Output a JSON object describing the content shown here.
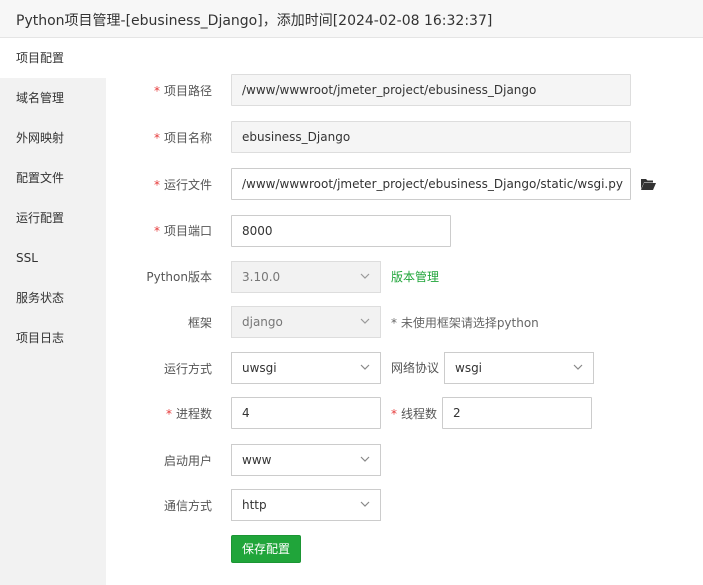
{
  "window": {
    "title": "Python项目管理-[ebusiness_Django]，添加时间[2024-02-08 16:32:37]"
  },
  "sidebar": {
    "items": [
      {
        "label": "项目配置",
        "active": true
      },
      {
        "label": "域名管理"
      },
      {
        "label": "外网映射"
      },
      {
        "label": "配置文件"
      },
      {
        "label": "运行配置"
      },
      {
        "label": "SSL"
      },
      {
        "label": "服务状态"
      },
      {
        "label": "项目日志"
      }
    ]
  },
  "form": {
    "required_mark": "*",
    "project_path": {
      "label": "项目路径",
      "value": "/www/wwwroot/jmeter_project/ebusiness_Django"
    },
    "project_name": {
      "label": "项目名称",
      "value": "ebusiness_Django"
    },
    "run_file": {
      "label": "运行文件",
      "value": "/www/wwwroot/jmeter_project/ebusiness_Django/static/wsgi.py",
      "icon": "folder-open-icon"
    },
    "project_port": {
      "label": "项目端口",
      "value": "8000"
    },
    "python_version": {
      "label": "Python版本",
      "value": "3.10.0",
      "link": "版本管理"
    },
    "framework": {
      "label": "框架",
      "value": "django",
      "hint": "* 未使用框架请选择python"
    },
    "run_mode": {
      "label": "运行方式",
      "value": "uwsgi"
    },
    "network_protocol": {
      "label": "网络协议",
      "value": "wsgi"
    },
    "processes": {
      "label": "进程数",
      "value": "4"
    },
    "threads": {
      "label": "线程数",
      "value": "2"
    },
    "start_user": {
      "label": "启动用户",
      "value": "www"
    },
    "comm_mode": {
      "label": "通信方式",
      "value": "http"
    },
    "save_label": "保存配置"
  },
  "colors": {
    "accent": "#20a53a",
    "required": "#e63b3b"
  }
}
